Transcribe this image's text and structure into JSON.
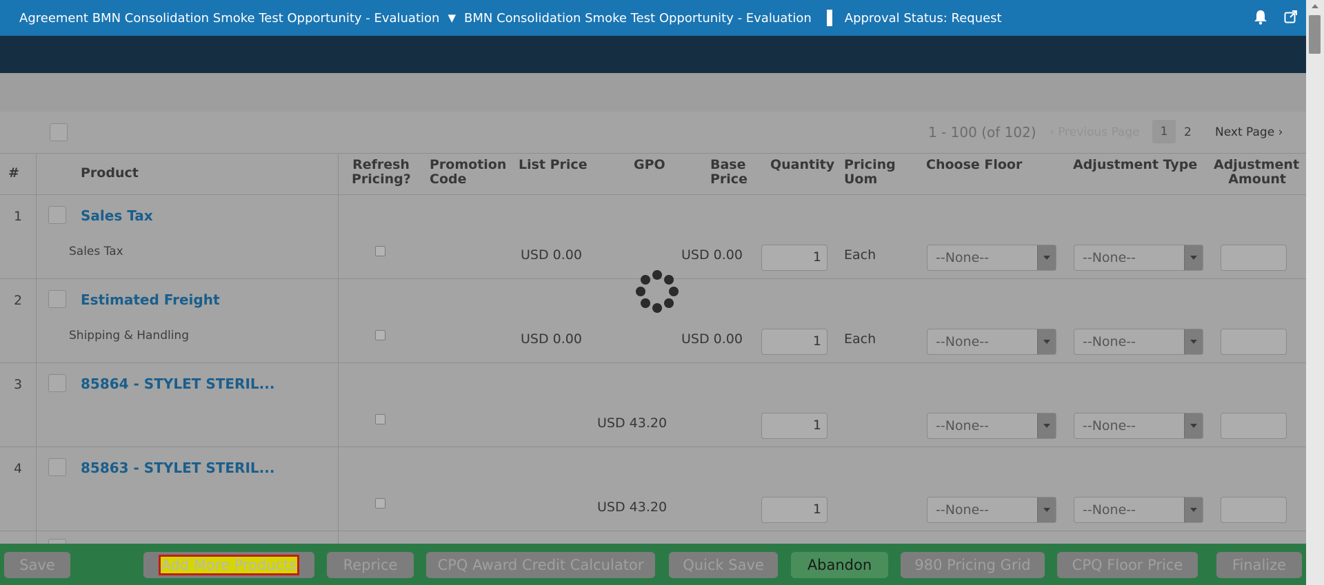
{
  "header": {
    "agreement_title": "Agreement BMN Consolidation Smoke Test Opportunity - Evaluation",
    "opportunity_title": "BMN Consolidation Smoke Test Opportunity - Evaluation",
    "approval_status": "Approval Status: Request",
    "icons": [
      "caret-down-icon",
      "bell-icon",
      "external-link-icon"
    ]
  },
  "pager": {
    "count_text": "1 - 100 (of 102)",
    "previous_label": "‹ Previous Page",
    "pages": [
      "1",
      "2"
    ],
    "current_page": "1",
    "next_label": "Next Page ›"
  },
  "table": {
    "columns": {
      "num": "#",
      "product": "Product",
      "refresh": "Refresh Pricing?",
      "promo": "Promotion Code",
      "list_price": "List Price",
      "gpo": "GPO",
      "base_price": "Base Price",
      "quantity": "Quantity",
      "uom": "Pricing Uom",
      "floor": "Choose Floor",
      "adj_type": "Adjustment Type",
      "adj_amount": "Adjustment Amount"
    },
    "rows": [
      {
        "num": "1",
        "name": "Sales Tax",
        "sub": "Sales Tax",
        "list_price": "USD 0.00",
        "gpo": "",
        "base_price": "USD 0.00",
        "quantity": "1",
        "uom": "Each",
        "floor": "--None--",
        "adj_type": "--None--"
      },
      {
        "num": "2",
        "name": "Estimated Freight",
        "sub": "Shipping & Handling",
        "list_price": "USD 0.00",
        "gpo": "",
        "base_price": "USD 0.00",
        "quantity": "1",
        "uom": "Each",
        "floor": "--None--",
        "adj_type": "--None--"
      },
      {
        "num": "3",
        "name": "85864 - STYLET STERIL...",
        "sub": "",
        "list_price": "",
        "gpo": "USD 43.20",
        "base_price": "",
        "quantity": "1",
        "uom": "",
        "floor": "--None--",
        "adj_type": "--None--"
      },
      {
        "num": "4",
        "name": "85863 - STYLET STERIL...",
        "sub": "",
        "list_price": "",
        "gpo": "USD 43.20",
        "base_price": "",
        "quantity": "1",
        "uom": "",
        "floor": "--None--",
        "adj_type": "--None--"
      }
    ]
  },
  "footer": {
    "save": "Save",
    "add_more": "Add More Products",
    "reprice": "Reprice",
    "award_credit": "CPQ Award Credit Calculator",
    "quick_save": "Quick Save",
    "abandon": "Abandon",
    "pricing_grid": "980 Pricing Grid",
    "floor_price": "CPQ Floor Price",
    "finalize": "Finalize"
  }
}
